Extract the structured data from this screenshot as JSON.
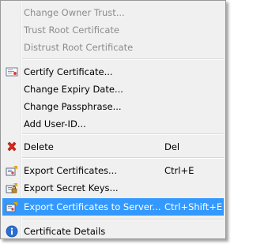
{
  "menu": {
    "items": [
      {
        "label": "Change Owner Trust...",
        "shortcut": "",
        "disabled": true,
        "icon": ""
      },
      {
        "label": "Trust Root Certificate",
        "shortcut": "",
        "disabled": true,
        "icon": ""
      },
      {
        "label": "Distrust Root Certificate",
        "shortcut": "",
        "disabled": true,
        "icon": ""
      },
      {
        "label": "Certify Certificate...",
        "shortcut": "",
        "disabled": false,
        "icon": "certify-icon"
      },
      {
        "label": "Change Expiry Date...",
        "shortcut": "",
        "disabled": false,
        "icon": ""
      },
      {
        "label": "Change Passphrase...",
        "shortcut": "",
        "disabled": false,
        "icon": ""
      },
      {
        "label": "Add User-ID...",
        "shortcut": "",
        "disabled": false,
        "icon": ""
      },
      {
        "label": "Delete",
        "shortcut": "Del",
        "disabled": false,
        "icon": "delete-icon"
      },
      {
        "label": "Export Certificates...",
        "shortcut": "Ctrl+E",
        "disabled": false,
        "icon": "export-icon"
      },
      {
        "label": "Export Secret Keys...",
        "shortcut": "",
        "disabled": false,
        "icon": "export-secret-icon"
      },
      {
        "label": "Export Certificates to Server...",
        "shortcut": "Ctrl+Shift+E",
        "disabled": false,
        "highlighted": true,
        "icon": "export-server-icon"
      },
      {
        "label": "Certificate Details",
        "shortcut": "",
        "disabled": false,
        "icon": "info-icon"
      }
    ]
  },
  "colors": {
    "highlight": "#3399ff",
    "disabled_text": "#8c8c8c",
    "menu_bg": "#f0f0f0"
  }
}
